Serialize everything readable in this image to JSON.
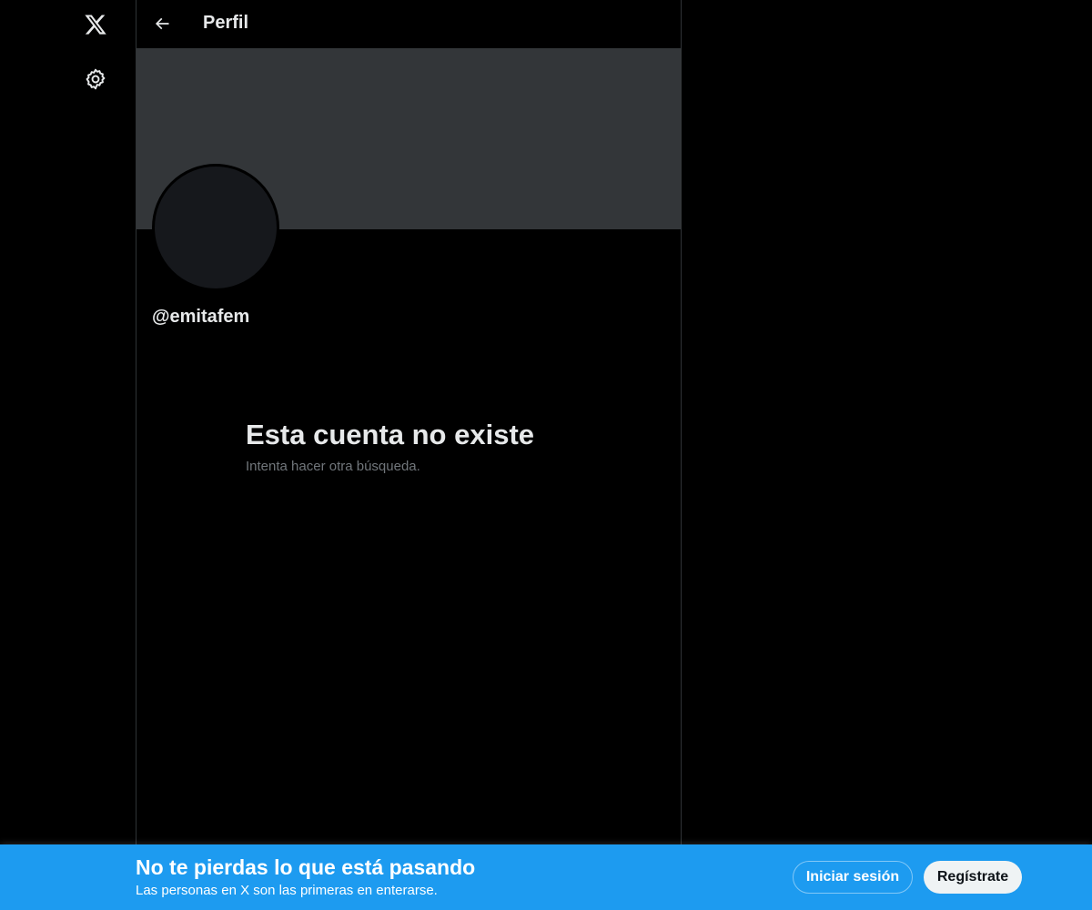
{
  "nav": {
    "logo_icon": "x-logo-icon",
    "settings_icon": "gear-icon"
  },
  "header": {
    "back_icon": "arrow-left-icon",
    "title": "Perfil"
  },
  "profile": {
    "handle": "@emitafem"
  },
  "empty_state": {
    "title": "Esta cuenta no existe",
    "subtitle": "Intenta hacer otra búsqueda."
  },
  "bottom_bar": {
    "title": "No te pierdas lo que está pasando",
    "subtitle": "Las personas en X son las primeras en enterarse.",
    "login_label": "Iniciar sesión",
    "signup_label": "Regístrate"
  },
  "colors": {
    "background": "#000000",
    "banner": "#333639",
    "accent": "#1d9bf0",
    "text_primary": "#e7e9ea",
    "text_secondary": "#71767b"
  }
}
